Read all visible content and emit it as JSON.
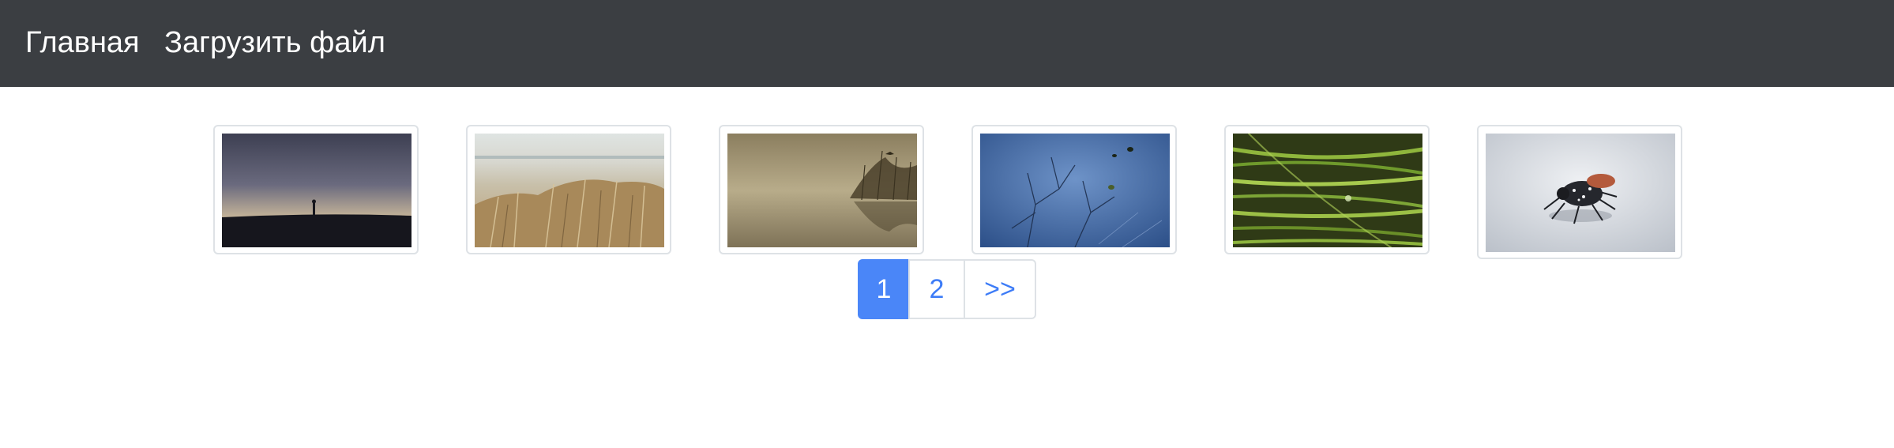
{
  "nav": {
    "home_label": "Главная",
    "upload_label": "Загрузить файл"
  },
  "gallery": {
    "items": [
      {
        "icon": "dusk-silhouette-photo"
      },
      {
        "icon": "beach-dune-grass-photo"
      },
      {
        "icon": "misty-reeds-photo"
      },
      {
        "icon": "frozen-branches-photo"
      },
      {
        "icon": "green-grass-photo"
      },
      {
        "icon": "beetle-photo"
      }
    ]
  },
  "pagination": {
    "pages": [
      "1",
      "2"
    ],
    "current": "1",
    "next_label": ">>"
  },
  "colors": {
    "navbar": "#3b3e42",
    "accent": "#4a86f8",
    "link": "#3d7cf7"
  }
}
